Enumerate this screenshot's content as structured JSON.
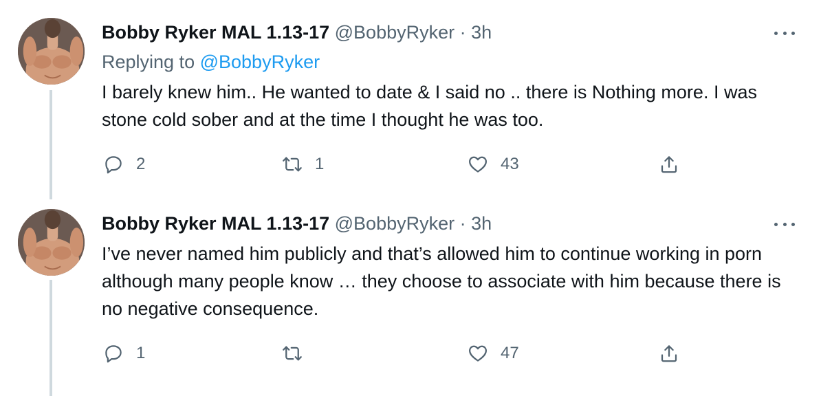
{
  "tweets": [
    {
      "author_name": "Bobby Ryker MAL 1.13-17",
      "handle": "@BobbyRyker",
      "separator": "·",
      "time": "3h",
      "replying_prefix": "Replying to",
      "replying_to": "@BobbyRyker",
      "text": "I barely knew him.. He wanted to date & I said no .. there is Nothing more. I was stone cold sober and at the time I thought he was too.",
      "reply_count": "2",
      "retweet_count": "1",
      "like_count": "43"
    },
    {
      "author_name": "Bobby Ryker MAL 1.13-17",
      "handle": "@BobbyRyker",
      "separator": "·",
      "time": "3h",
      "text": "I’ve never named him publicly and that’s allowed him to continue working in porn although many people know … they choose to associate with him because there is no negative consequence.",
      "reply_count": "1",
      "retweet_count": "",
      "like_count": "47"
    }
  ],
  "icons": {
    "reply": "reply-icon",
    "retweet": "retweet-icon",
    "like": "heart-icon",
    "share": "share-icon",
    "more": "more-icon"
  },
  "colors": {
    "text_primary": "#0f1419",
    "text_secondary": "#536471",
    "link": "#1d9bf0",
    "thread_line": "#cfd9de"
  }
}
